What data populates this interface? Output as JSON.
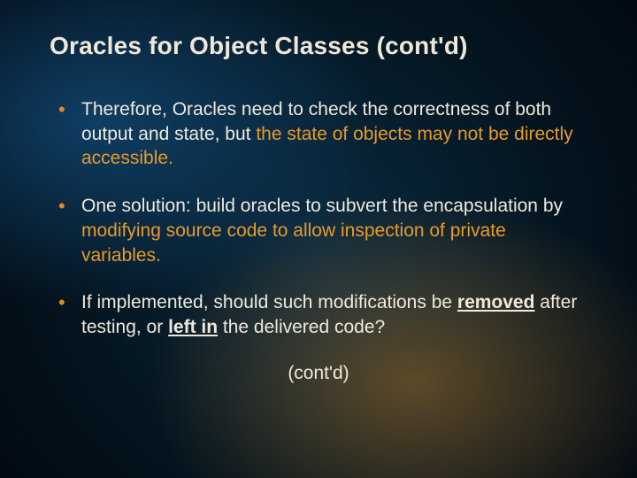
{
  "title": "Oracles for Object Classes (cont'd)",
  "b1": {
    "pre": "Therefore, Oracles need to check the correctness of both output and state, but ",
    "hl": "the state of objects may not be directly accessible."
  },
  "b2": {
    "pre": "One solution: build oracles to subvert the encapsulation by ",
    "hl": "modifying source code to allow inspection of private variables."
  },
  "b3": {
    "a": "If implemented, should such modifications be ",
    "rem": "removed",
    "b": " after testing, or ",
    "left": "left in",
    "c": " the delivered code?"
  },
  "contd": "(cont'd)"
}
